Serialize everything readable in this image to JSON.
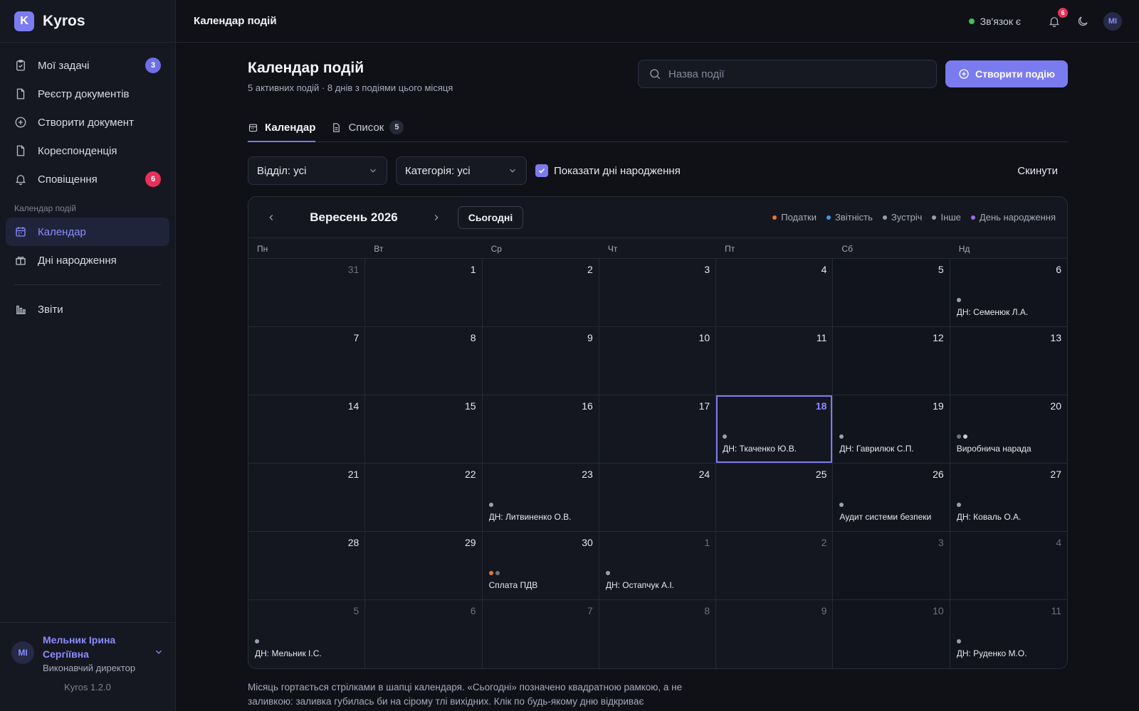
{
  "brand": {
    "logo_letter": "K",
    "name": "Kyros"
  },
  "sidebar": {
    "items": [
      {
        "label": "Мої задачі",
        "badge": "3",
        "icon": "clipboard-icon"
      },
      {
        "label": "Реєстр документів",
        "icon": "document-icon"
      },
      {
        "label": "Створити документ",
        "icon": "plus-circle-icon"
      },
      {
        "label": "Кореспонденція",
        "icon": "document-icon"
      },
      {
        "label": "Сповіщення",
        "badge": "6",
        "icon": "bell-icon"
      }
    ],
    "section_label": "Календар подій",
    "calendar_items": [
      {
        "label": "Календар",
        "icon": "calendar-icon",
        "active": true
      },
      {
        "label": "Дні народження",
        "icon": "gift-icon"
      }
    ],
    "reports": {
      "label": "Звіти",
      "icon": "bar-chart-icon"
    },
    "user": {
      "initials": "MI",
      "name": "Мельник Ірина Сергіївна",
      "role": "Виконавчий директор"
    },
    "version": "Kyros 1.2.0"
  },
  "topbar": {
    "title": "Календар подій",
    "connection": "Зв'язок є",
    "notifications_count": "6",
    "avatar": "MI"
  },
  "page": {
    "title": "Календар подій",
    "subtitle": "5 активних подій · 8 днів з подіями цього місяця",
    "search_placeholder": "Назва події",
    "create_label": "Створити подію",
    "tabs": [
      {
        "label": "Календар",
        "active": true
      },
      {
        "label": "Список",
        "count": "5"
      }
    ],
    "filters": {
      "department": "Відділ: усі",
      "category": "Категорія: усі",
      "show_birthdays": "Показати дні народження",
      "reset": "Скинути"
    }
  },
  "calendar": {
    "month_label": "Вересень 2026",
    "today_label": "Сьогодні",
    "legend": [
      {
        "label": "Податки",
        "color": "#e8772e"
      },
      {
        "label": "Звітність",
        "color": "#3b9be8"
      },
      {
        "label": "Зустріч",
        "color": "#9aa0b0"
      },
      {
        "label": "Інше",
        "color": "#9aa0b0"
      },
      {
        "label": "День народження",
        "color": "#9b6cf2"
      }
    ],
    "weekdays": [
      "Пн",
      "Вт",
      "Ср",
      "Чт",
      "Пт",
      "Сб",
      "Нд"
    ],
    "days": [
      {
        "n": "31",
        "muted": true
      },
      {
        "n": "1"
      },
      {
        "n": "2"
      },
      {
        "n": "3"
      },
      {
        "n": "4"
      },
      {
        "n": "5"
      },
      {
        "n": "6",
        "dots": [
          "#9aa0b0"
        ],
        "event": "ДН: Семенюк Л.А."
      },
      {
        "n": "7"
      },
      {
        "n": "8"
      },
      {
        "n": "9"
      },
      {
        "n": "10"
      },
      {
        "n": "11"
      },
      {
        "n": "12"
      },
      {
        "n": "13"
      },
      {
        "n": "14"
      },
      {
        "n": "15"
      },
      {
        "n": "16"
      },
      {
        "n": "17"
      },
      {
        "n": "18",
        "today": true,
        "dots": [
          "#9aa0b0"
        ],
        "event": "ДН: Ткаченко Ю.В."
      },
      {
        "n": "19",
        "dots": [
          "#9aa0b0"
        ],
        "event": "ДН: Гаврилюк С.П."
      },
      {
        "n": "20",
        "dots": [
          "#6c7182",
          "#c9ccd6"
        ],
        "event": "Виробнича нарада"
      },
      {
        "n": "21"
      },
      {
        "n": "22"
      },
      {
        "n": "23",
        "dots": [
          "#9aa0b0"
        ],
        "event": "ДН: Литвиненко О.В."
      },
      {
        "n": "24"
      },
      {
        "n": "25"
      },
      {
        "n": "26",
        "dots": [
          "#9aa0b0"
        ],
        "event": "Аудит системи безпеки"
      },
      {
        "n": "27",
        "dots": [
          "#9aa0b0"
        ],
        "event": "ДН: Коваль О.А."
      },
      {
        "n": "28"
      },
      {
        "n": "29"
      },
      {
        "n": "30",
        "dots": [
          "#e8772e",
          "#6c7182"
        ],
        "event": "Сплата ПДВ"
      },
      {
        "n": "1",
        "muted": true,
        "dots": [
          "#9aa0b0"
        ],
        "event": "ДН: Остапчук А.І."
      },
      {
        "n": "2",
        "muted": true
      },
      {
        "n": "3",
        "muted": true
      },
      {
        "n": "4",
        "muted": true
      },
      {
        "n": "5",
        "muted": true,
        "dots": [
          "#9aa0b0"
        ],
        "event": "ДН: Мельник І.С."
      },
      {
        "n": "6",
        "muted": true
      },
      {
        "n": "7",
        "muted": true
      },
      {
        "n": "8",
        "muted": true
      },
      {
        "n": "9",
        "muted": true
      },
      {
        "n": "10",
        "muted": true
      },
      {
        "n": "11",
        "muted": true,
        "dots": [
          "#9aa0b0"
        ],
        "event": "ДН: Руденко М.О."
      }
    ]
  },
  "footnote": "Місяць гортається стрілками в шапці календаря. «Сьогодні» позначено квадратною рамкою, а не заливкою: заливка губилась би на сірому тлі вихідних. Клік по будь-якому дню відкриває"
}
